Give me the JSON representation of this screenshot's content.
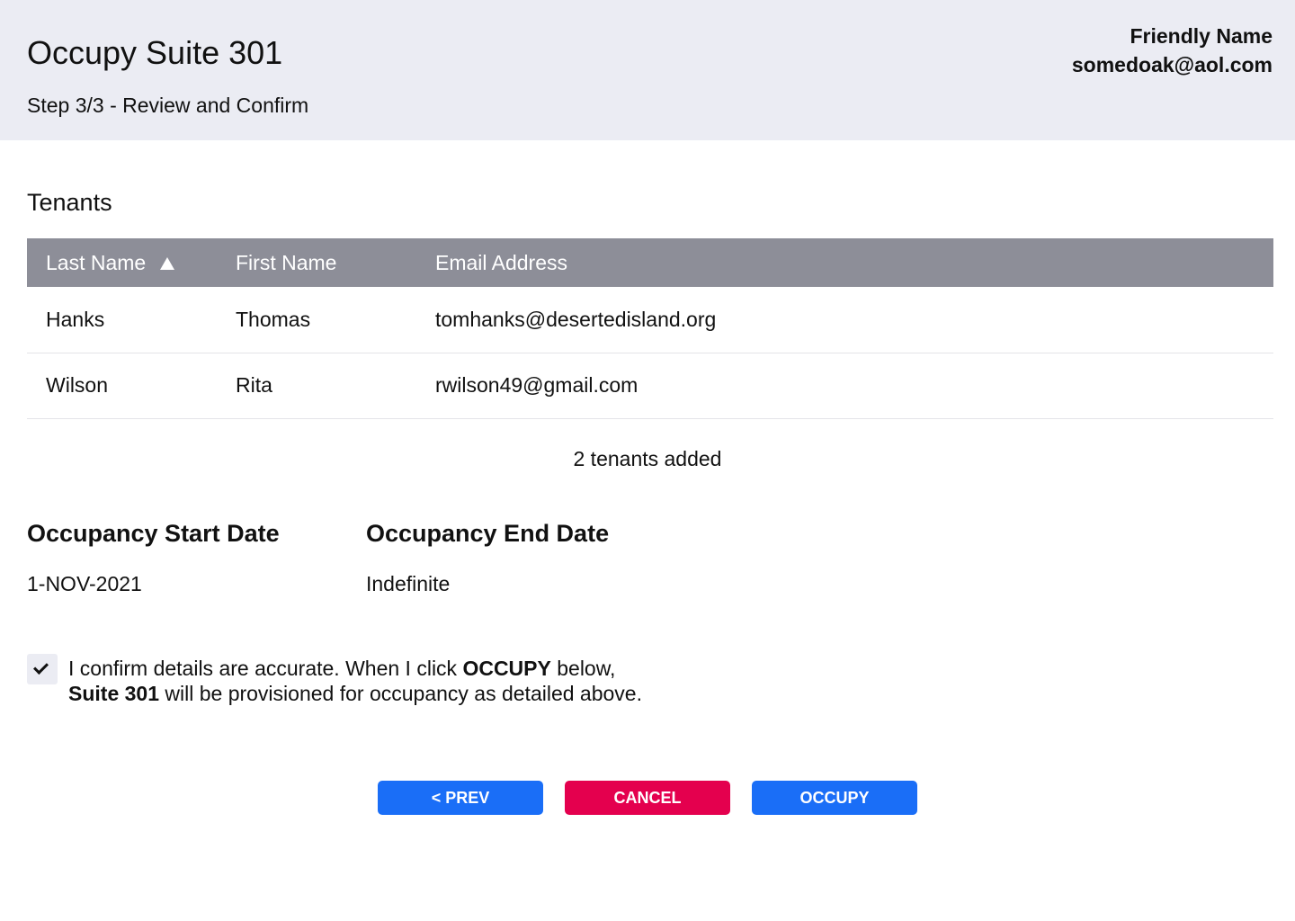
{
  "header": {
    "title": "Occupy Suite 301",
    "step": "Step 3/3 - Review and Confirm",
    "user_name": "Friendly Name",
    "user_email": "somedoak@aol.com"
  },
  "tenants": {
    "heading": "Tenants",
    "columns": [
      "Last Name",
      "First Name",
      "Email Address"
    ],
    "sort_icon": "triangle-up-icon",
    "rows": [
      {
        "last": "Hanks",
        "first": "Thomas",
        "email": "tomhanks@desertedisland.org"
      },
      {
        "last": "Wilson",
        "first": "Rita",
        "email": "rwilson49@gmail.com"
      }
    ],
    "count_text": "2 tenants added"
  },
  "occupancy": {
    "start_label": "Occupancy Start Date",
    "start_value": "1-NOV-2021",
    "end_label": "Occupancy End Date",
    "end_value": "Indefinite"
  },
  "confirm": {
    "checked": true,
    "text_1": "I confirm details are accurate.  When I click ",
    "text_bold_1": "OCCUPY",
    "text_2": " below,",
    "text_bold_2": "Suite 301",
    "text_3": " will be provisioned for occupancy as detailed above."
  },
  "buttons": {
    "prev": "< PREV",
    "cancel": "CANCEL",
    "occupy": "OCCUPY"
  },
  "colors": {
    "header_bg": "#ebecf3",
    "table_header_bg": "#8d8e98",
    "primary_blue": "#1a6ef7",
    "cancel_red": "#e4004e"
  }
}
